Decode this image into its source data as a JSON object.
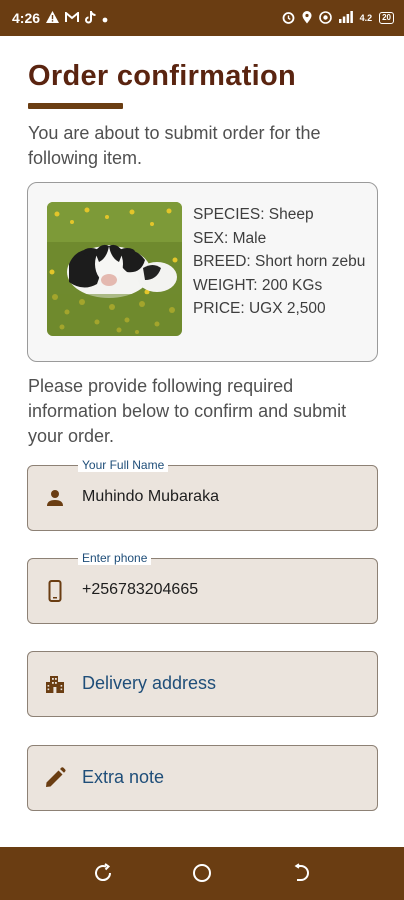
{
  "status_bar": {
    "time": "4:26",
    "left_icons": [
      "warning-icon",
      "gmail-icon",
      "tiktok-icon",
      "dot-icon"
    ],
    "right_icons": [
      "alarm-icon",
      "location-icon",
      "hotspot-icon",
      "signal-icon",
      "battery-icon"
    ],
    "network_text": "4.2",
    "battery_text": "20"
  },
  "page": {
    "title": "Order confirmation",
    "intro": "You are about to submit order for the following item.",
    "instructions": "Please provide following required information below to confirm and submit your order."
  },
  "product": {
    "image_subject": "cow-in-flower-field",
    "species": "SPECIES: Sheep",
    "sex": "SEX: Male",
    "breed": "BREED: Short horn zebu",
    "weight": "WEIGHT: 200 KGs",
    "price": "PRICE: UGX 2,500"
  },
  "form": {
    "full_name": {
      "label": "Your Full Name",
      "value": "Muhindo Mubaraka",
      "icon": "person-icon"
    },
    "phone": {
      "label": "Enter phone",
      "value": "+256783204665",
      "icon": "phone-icon"
    },
    "address": {
      "placeholder": "Delivery address",
      "icon": "building-icon"
    },
    "note": {
      "placeholder": "Extra note",
      "icon": "pencil-icon"
    }
  },
  "nav_bar": {
    "buttons": [
      "recents-button",
      "home-button",
      "back-button"
    ]
  },
  "colors": {
    "brand_brown": "#6a3d12",
    "title_maroon": "#5a2410",
    "field_fill": "#ebe4dd",
    "label_blue": "#1f4e79"
  }
}
